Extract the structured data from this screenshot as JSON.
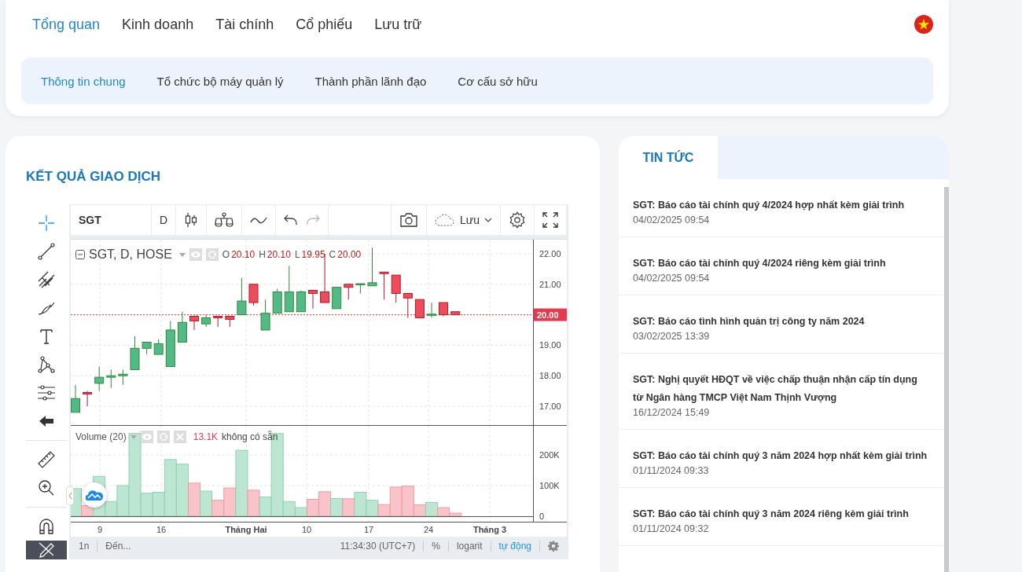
{
  "main_tabs": [
    {
      "label": "Tổng quan",
      "selected": true
    },
    {
      "label": "Kinh doanh",
      "selected": false
    },
    {
      "label": "Tài chính",
      "selected": false
    },
    {
      "label": "Cổ phiếu",
      "selected": false
    },
    {
      "label": "Lưu trữ",
      "selected": false
    }
  ],
  "sub_tabs": [
    {
      "label": "Thông tin chung",
      "selected": true
    },
    {
      "label": "Tổ chức bộ máy quản lý",
      "selected": false
    },
    {
      "label": "Thành phần lãnh đạo",
      "selected": false
    },
    {
      "label": "Cơ cấu sở hữu",
      "selected": false
    }
  ],
  "trading": {
    "title": "KẾT QUẢ GIAO DỊCH",
    "chart": {
      "symbol": "SGT",
      "interval": "D",
      "save_label": "Lưu",
      "legend": {
        "title": "SGT, D, HOSE",
        "ohlc": [
          {
            "key": "O",
            "value": "20.10"
          },
          {
            "key": "H",
            "value": "20.10"
          },
          {
            "key": "L",
            "value": "19.95"
          },
          {
            "key": "C",
            "value": "20.00"
          }
        ]
      },
      "price_ticks": [
        "22.00",
        "21.00",
        "19.00",
        "18.00",
        "17.00"
      ],
      "last_price": "20.00",
      "volume_legend": {
        "title": "Volume (20)",
        "value": "13.1K",
        "note": "không có sẵn"
      },
      "volume_ticks": [
        "200K",
        "100K",
        "0"
      ],
      "time_labels": [
        {
          "label": "9",
          "kind": "day"
        },
        {
          "label": "16",
          "kind": "day"
        },
        {
          "label": "Tháng Hai",
          "kind": "month"
        },
        {
          "label": "10",
          "kind": "day"
        },
        {
          "label": "17",
          "kind": "day"
        },
        {
          "label": "24",
          "kind": "day"
        },
        {
          "label": "Tháng 3",
          "kind": "month"
        }
      ],
      "bottom_bar": {
        "range": "1n",
        "goto": "Đến...",
        "clock": "11:34:30 (UTC+7)",
        "options": [
          {
            "label": "%",
            "selected": false
          },
          {
            "label": "logarit",
            "selected": false
          },
          {
            "label": "tự động",
            "selected": true
          }
        ]
      }
    }
  },
  "news": {
    "tab": "TIN TỨC",
    "items": [
      {
        "title": "SGT: Báo cáo tài chính quý 4/2024 hợp nhất kèm giải trình",
        "date": "04/02/2025 09:54"
      },
      {
        "title": "SGT: Báo cáo tài chính quý 4/2024 riêng kèm giải trình",
        "date": "04/02/2025 09:54"
      },
      {
        "title": "SGT: Báo cáo tình hình quản trị công ty năm 2024",
        "date": "03/02/2025 13:39"
      },
      {
        "title": "SGT: Nghị quyết HĐQT về việc chấp thuận nhận cấp tín dụng từ Ngân hàng TMCP Việt Nam Thịnh Vượng",
        "date": "16/12/2024 15:49"
      },
      {
        "title": "SGT: Báo cáo tài chính quý 3 năm 2024 hợp nhất kèm giải trình",
        "date": "01/11/2024 09:33"
      },
      {
        "title": "SGT: Báo cáo tài chính quý 3 năm 2024 riêng kèm giải trình",
        "date": "01/11/2024 09:32"
      }
    ]
  }
}
